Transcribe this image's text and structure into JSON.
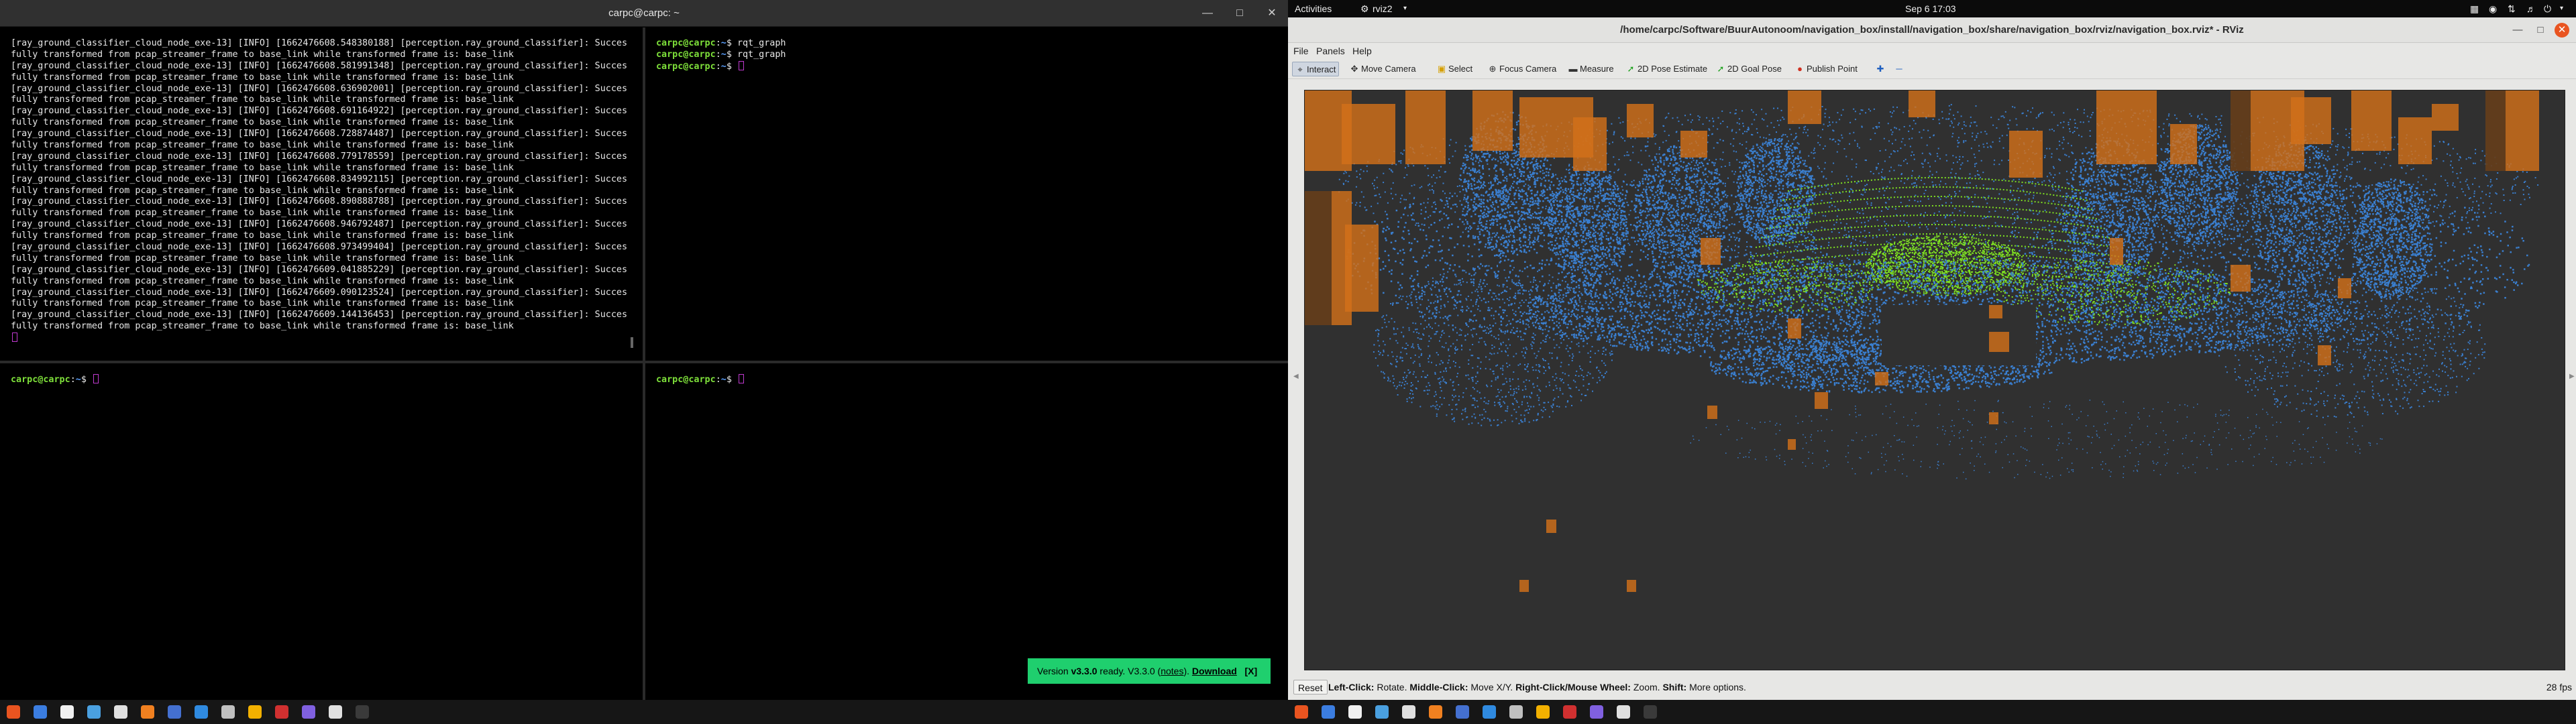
{
  "terminal": {
    "title": "carpc@carpc: ~",
    "top_left_lines": [
      "[ray_ground_classifier_cloud_node_exe-13] [INFO] [1662476608.548380188] [perception.ray_ground_classifier]: Succes",
      "fully transformed from pcap_streamer_frame to base_link while transformed frame is: base_link",
      "[ray_ground_classifier_cloud_node_exe-13] [INFO] [1662476608.581991348] [perception.ray_ground_classifier]: Succes",
      "fully transformed from pcap_streamer_frame to base_link while transformed frame is: base_link",
      "[ray_ground_classifier_cloud_node_exe-13] [INFO] [1662476608.636902001] [perception.ray_ground_classifier]: Succes",
      "fully transformed from pcap_streamer_frame to base_link while transformed frame is: base_link",
      "[ray_ground_classifier_cloud_node_exe-13] [INFO] [1662476608.691164922] [perception.ray_ground_classifier]: Succes",
      "fully transformed from pcap_streamer_frame to base_link while transformed frame is: base_link",
      "[ray_ground_classifier_cloud_node_exe-13] [INFO] [1662476608.728874487] [perception.ray_ground_classifier]: Succes",
      "fully transformed from pcap_streamer_frame to base_link while transformed frame is: base_link",
      "[ray_ground_classifier_cloud_node_exe-13] [INFO] [1662476608.779178559] [perception.ray_ground_classifier]: Succes",
      "fully transformed from pcap_streamer_frame to base_link while transformed frame is: base_link",
      "[ray_ground_classifier_cloud_node_exe-13] [INFO] [1662476608.834992115] [perception.ray_ground_classifier]: Succes",
      "fully transformed from pcap_streamer_frame to base_link while transformed frame is: base_link",
      "[ray_ground_classifier_cloud_node_exe-13] [INFO] [1662476608.890888788] [perception.ray_ground_classifier]: Succes",
      "fully transformed from pcap_streamer_frame to base_link while transformed frame is: base_link",
      "[ray_ground_classifier_cloud_node_exe-13] [INFO] [1662476608.946792487] [perception.ray_ground_classifier]: Succes",
      "fully transformed from pcap_streamer_frame to base_link while transformed frame is: base_link",
      "[ray_ground_classifier_cloud_node_exe-13] [INFO] [1662476608.973499404] [perception.ray_ground_classifier]: Succes",
      "fully transformed from pcap_streamer_frame to base_link while transformed frame is: base_link",
      "[ray_ground_classifier_cloud_node_exe-13] [INFO] [1662476609.041885229] [perception.ray_ground_classifier]: Succes",
      "fully transformed from pcap_streamer_frame to base_link while transformed frame is: base_link",
      "[ray_ground_classifier_cloud_node_exe-13] [INFO] [1662476609.090123524] [perception.ray_ground_classifier]: Succes",
      "fully transformed from pcap_streamer_frame to base_link while transformed frame is: base_link",
      "[ray_ground_classifier_cloud_node_exe-13] [INFO] [1662476609.144136453] [perception.ray_ground_classifier]: Succes",
      "fully transformed from pcap_streamer_frame to base_link while transformed frame is: base_link"
    ],
    "prompt_user": "carpc@carpc",
    "prompt_sep": ":",
    "prompt_path": "~",
    "prompt_dollar": "$ ",
    "top_right_commands": [
      "rqt_graph",
      "rqt_graph",
      ""
    ],
    "version_toast": {
      "prefix": "Version ",
      "version": "v3.3.0",
      "middle": " ready. V3.3.0 (",
      "notes": "notes",
      "after_notes": "). ",
      "download": "Download",
      "close": "[X]"
    }
  },
  "gnome": {
    "activities": "Activities",
    "app_name": "rviz2",
    "clock": "Sep 6  17:03"
  },
  "rviz": {
    "title": "/home/carpc/Software/BuurAutonoom/navigation_box/install/navigation_box/share/navigation_box/rviz/navigation_box.rviz* - RViz",
    "menu": [
      "File",
      "Panels",
      "Help"
    ],
    "tools": [
      {
        "label": "Interact",
        "icon": "interact-icon",
        "active": true
      },
      {
        "label": "Move Camera",
        "icon": "move-camera-icon"
      },
      {
        "label": "Select",
        "icon": "select-icon"
      },
      {
        "label": "Focus Camera",
        "icon": "focus-camera-icon"
      },
      {
        "label": "Measure",
        "icon": "measure-icon"
      },
      {
        "label": "2D Pose Estimate",
        "icon": "pose-estimate-icon"
      },
      {
        "label": "2D Goal Pose",
        "icon": "goal-pose-icon"
      },
      {
        "label": "Publish Point",
        "icon": "publish-point-icon"
      }
    ],
    "status": {
      "reset_label": "Reset",
      "left_click_key": "Left-Click:",
      "left_click_val": " Rotate. ",
      "middle_click_key": "Middle-Click:",
      "middle_click_val": " Move X/Y. ",
      "right_click_key": "Right-Click/Mouse Wheel:",
      "right_click_val": " Zoom. ",
      "shift_key": "Shift:",
      "shift_val": " More options.",
      "fps": "28 fps"
    },
    "colors": {
      "background": "#303030",
      "obstacle_points": "#3a7fd0",
      "ground_points": "#7ee022",
      "bounding_boxes": "#d2701a"
    }
  }
}
